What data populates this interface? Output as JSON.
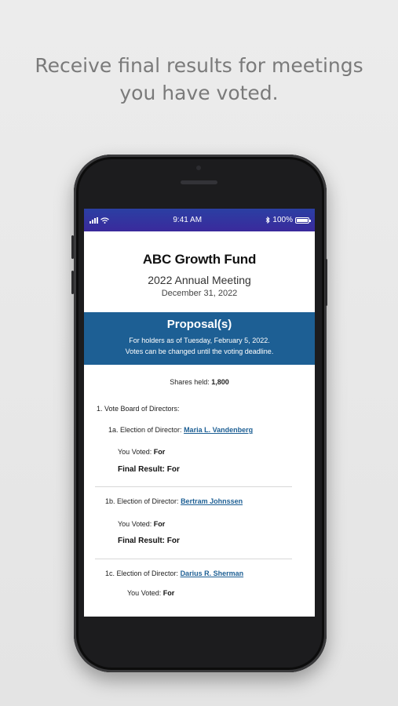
{
  "headline": {
    "line1": "Receive final results for meetings",
    "line2": "you have voted."
  },
  "status_bar": {
    "time": "9:41 AM",
    "battery": "100%",
    "icons": [
      "signal-bars-icon",
      "wifi-icon",
      "bluetooth-icon",
      "battery-icon"
    ]
  },
  "meeting": {
    "fund_name": "ABC Growth Fund",
    "meeting_name": "2022 Annual Meeting",
    "meeting_date": "December 31, 2022"
  },
  "banner": {
    "title": "Proposal(s)",
    "line1": "For holders as of Tuesday, February 5, 2022.",
    "line2": "Votes can be changed until the voting deadline."
  },
  "shares": {
    "label": "Shares held:",
    "value": "1,800"
  },
  "proposal": {
    "title": "1.  Vote Board of Directors:",
    "items": [
      {
        "label": "1a. Election of Director:",
        "director": "Maria L. Vandenberg",
        "voted_label": "You Voted:",
        "voted_value": "For",
        "final_label": "Final Result:",
        "final_value": "For"
      },
      {
        "label": "1b. Election of Director:",
        "director": "Bertram Johnssen",
        "voted_label": "You Voted:",
        "voted_value": "For",
        "final_label": "Final Result:",
        "final_value": "For"
      },
      {
        "label": "1c. Election of Director:",
        "director": "Darius R. Sherman",
        "voted_label": "You Voted:",
        "voted_value": "For"
      }
    ]
  },
  "colors": {
    "banner": "#1d5f94",
    "status_bar": "#2b3fa3",
    "link": "#1d5f94"
  }
}
